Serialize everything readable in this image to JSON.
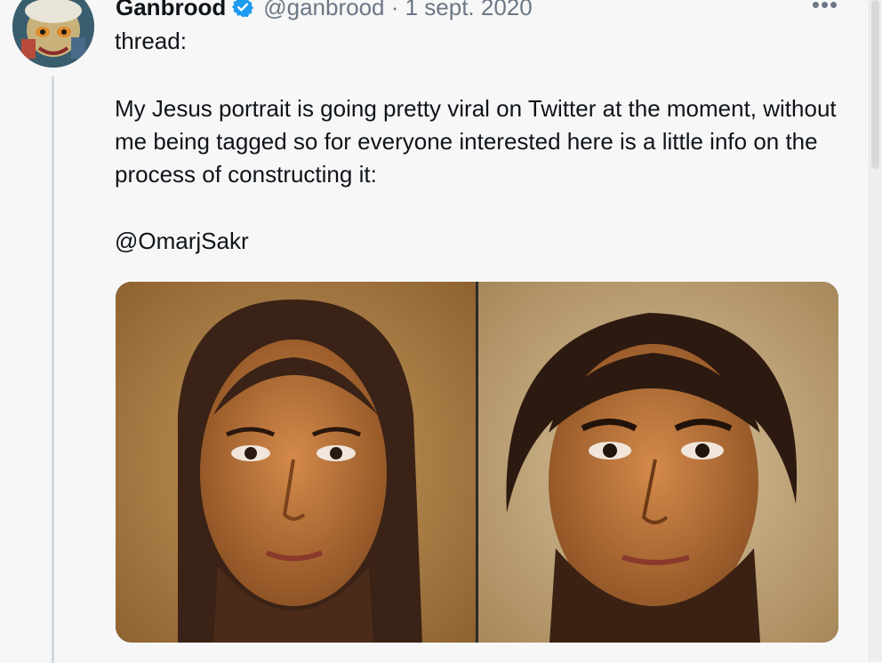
{
  "tweet": {
    "author": {
      "display_name": "Ganbrood",
      "handle_date": "@ganbrood · 1 sept. 2020",
      "verified": true,
      "avatar": "avatar-icon"
    },
    "text": {
      "intro": "thread:",
      "body": "My Jesus portrait is going pretty viral on Twitter at the moment, without me being tagged so for everyone interested here is a little info on the process of constructing it:",
      "mention": "@OmarjSakr"
    },
    "more_icon": "more-options-icon",
    "media": {
      "panels": [
        "portrait-long-hair",
        "portrait-short-hair"
      ]
    }
  },
  "colors": {
    "verified_blue": "#1d9bf0",
    "secondary_text": "#6b7785",
    "thread_line": "#cfd9de",
    "background": "#f7f7f8"
  }
}
